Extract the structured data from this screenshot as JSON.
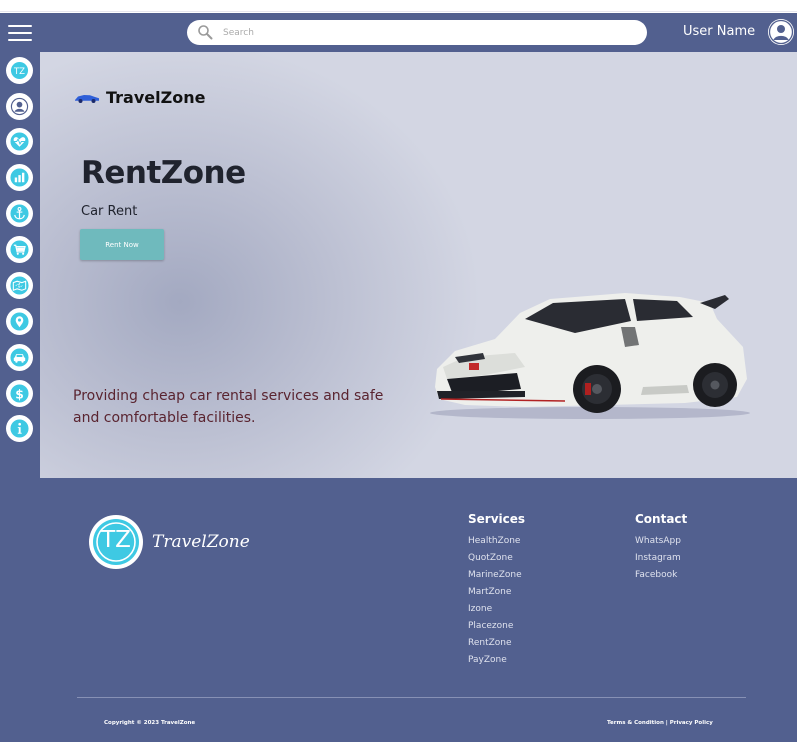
{
  "header": {
    "search_placeholder": "Search",
    "user_name": "User Name"
  },
  "sidebar": {
    "items": [
      {
        "icon": "tz-logo-icon"
      },
      {
        "icon": "user-profile-icon"
      },
      {
        "icon": "health-heart-icon"
      },
      {
        "icon": "bar-chart-icon"
      },
      {
        "icon": "anchor-icon"
      },
      {
        "icon": "shopping-cart-icon"
      },
      {
        "icon": "travel-map-icon"
      },
      {
        "icon": "location-pin-icon"
      },
      {
        "icon": "car-icon"
      },
      {
        "icon": "dollar-icon"
      },
      {
        "icon": "info-icon"
      }
    ]
  },
  "hero": {
    "brand": "TravelZone",
    "title": "RentZone",
    "subtitle": "Car Rent",
    "button_label": "Rent Now",
    "description": "Providing cheap car rental services and safe and comfortable facilities."
  },
  "footer": {
    "logo_text": "TravelZone",
    "logo_initials": "TZ",
    "services_heading": "Services",
    "services": [
      "HealthZone",
      "QuotZone",
      "MarineZone",
      "MartZone",
      "Izone",
      "Placezone",
      "RentZone",
      "PayZone"
    ],
    "contact_heading": "Contact",
    "contact": [
      "WhatsApp",
      "Instagram",
      "Facebook"
    ],
    "copyright": "Copyright © 2023 TravelZone",
    "terms": "Terms & Condition | Privacy Policy"
  },
  "colors": {
    "primary": "#52608f",
    "accent": "#6fbabd",
    "icon_cyan": "#3ec9e3",
    "hero_bg": "#d3d6e3",
    "desc_text": "#5a2430"
  }
}
